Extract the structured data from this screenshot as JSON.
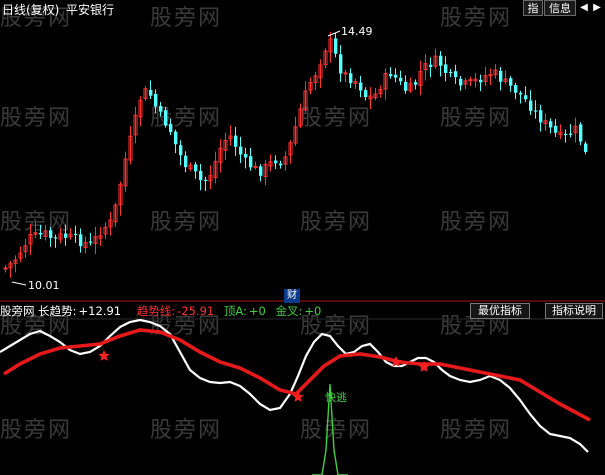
{
  "header": {
    "chart_title": "日线(复权)",
    "stock_name": "平安银行",
    "toolbar": {
      "btn_index": "指",
      "btn_info": "信息"
    }
  },
  "watermark": "股旁网",
  "price_panel": {
    "high_label": "14.49",
    "low_label": "10.01",
    "finance_badge": "财"
  },
  "indicator_bar": {
    "source": "股旁网 长趋势:",
    "long_trend_value": "+12.91",
    "trend_line_label": "趋势线:",
    "trend_line_value": "-25.91",
    "top_a_label": "顶A:",
    "top_a_value": "+0",
    "golden_cross_label": "金叉:",
    "golden_cross_value": "+0",
    "best_indicator_btn": "最优指标",
    "indicator_help_btn": "指标说明"
  },
  "signal_label": "快逃",
  "colors": {
    "background": "#000000",
    "up_candle": "#ff3232",
    "down_candle": "#54ffff",
    "long_trend_line": "#ffffff",
    "trend_line": "#e8191b",
    "signal": "#3fd13f",
    "star": "#ff2020"
  },
  "chart_data": {
    "type": "candlestick",
    "price_labels": {
      "max": 14.49,
      "min": 10.01
    },
    "indicator_series": [
      {
        "name": "长趋势",
        "last_value": 12.91
      },
      {
        "name": "趋势线",
        "last_value": -25.91
      },
      {
        "name": "顶A",
        "last_value": 0
      },
      {
        "name": "金叉",
        "last_value": 0
      }
    ]
  }
}
